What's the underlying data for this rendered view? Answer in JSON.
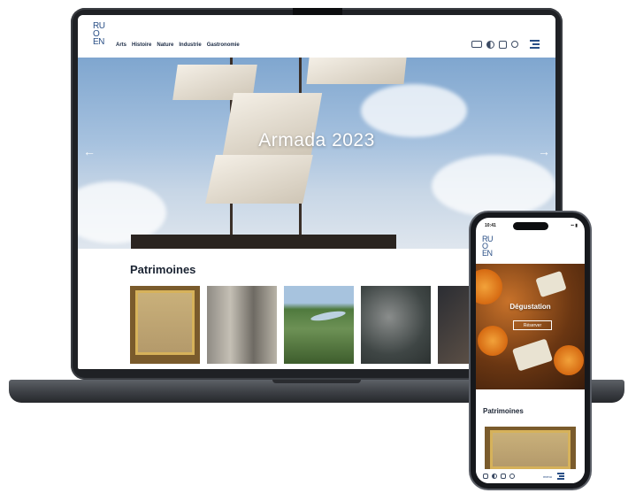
{
  "laptop": {
    "logo": [
      "RU",
      "O",
      "EN"
    ],
    "nav": [
      "Arts",
      "Histoire",
      "Nature",
      "Industrie",
      "Gastronomie"
    ],
    "hero_title": "Armada 2023",
    "section_title": "Patrimoines",
    "tool_icons": [
      "mail-icon",
      "contrast-icon",
      "bag-icon",
      "search-icon",
      "menu-icon"
    ]
  },
  "phone": {
    "status_time": "10:41",
    "status_indicators": "▪▪ ▮",
    "logo": [
      "RU",
      "O",
      "EN"
    ],
    "hero_title": "Dégustation",
    "hero_button": "Réserver",
    "section_title": "Patrimoines",
    "menu_label": "menu"
  }
}
